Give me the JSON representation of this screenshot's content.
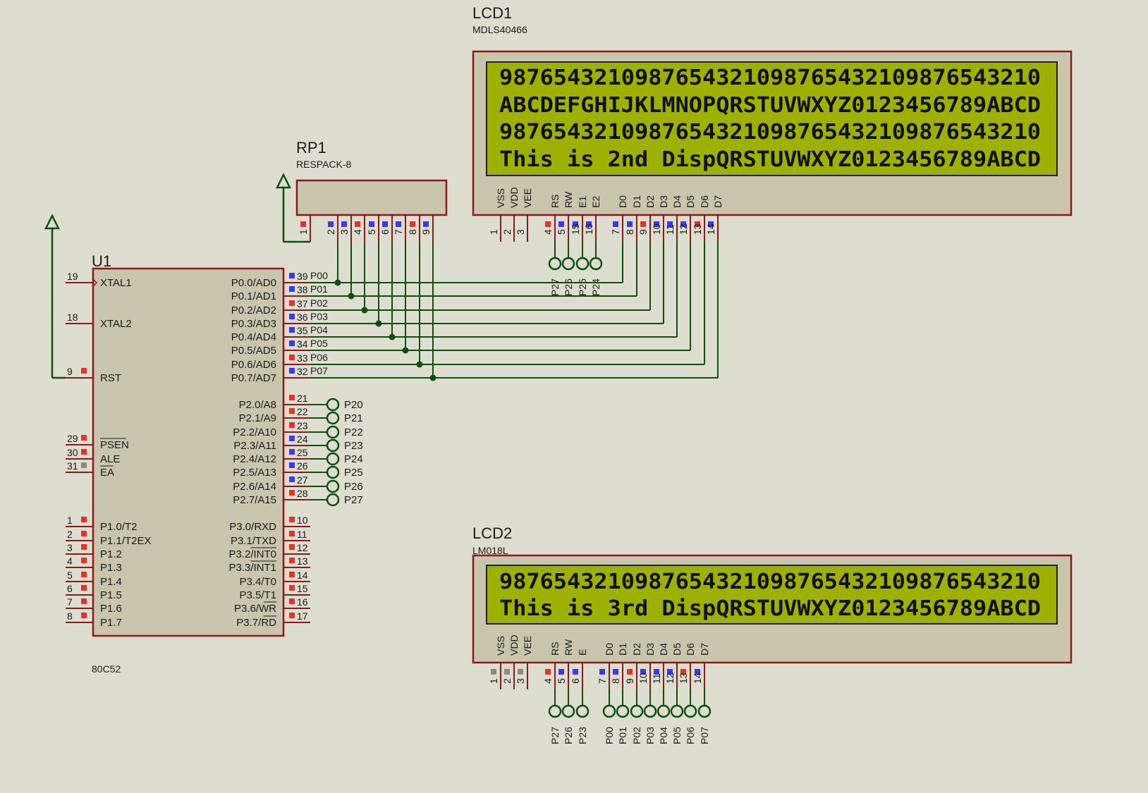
{
  "u1": {
    "ref": "U1",
    "part": "80C52",
    "left_pins": [
      {
        "num": "19",
        "name": "XTAL1",
        "dot": "none"
      },
      {
        "num": "18",
        "name": "XTAL2",
        "dot": "none"
      },
      {
        "num": "9",
        "name": "RST",
        "dot": "red"
      },
      {
        "num": "29",
        "name": "PSEN",
        "dot": "red",
        "overline": true
      },
      {
        "num": "30",
        "name": "ALE",
        "dot": "red"
      },
      {
        "num": "31",
        "name": "EA",
        "dot": "gray",
        "overline": true
      },
      {
        "num": "1",
        "name": "P1.0/T2",
        "dot": "red"
      },
      {
        "num": "2",
        "name": "P1.1/T2EX",
        "dot": "red"
      },
      {
        "num": "3",
        "name": "P1.2",
        "dot": "red"
      },
      {
        "num": "4",
        "name": "P1.3",
        "dot": "red"
      },
      {
        "num": "5",
        "name": "P1.4",
        "dot": "red"
      },
      {
        "num": "6",
        "name": "P1.5",
        "dot": "red"
      },
      {
        "num": "7",
        "name": "P1.6",
        "dot": "red"
      },
      {
        "num": "8",
        "name": "P1.7",
        "dot": "red"
      }
    ],
    "port0": [
      {
        "num": "39",
        "name": "P0.0/AD0",
        "net": "P00",
        "dot": "blue"
      },
      {
        "num": "38",
        "name": "P0.1/AD1",
        "net": "P01",
        "dot": "blue"
      },
      {
        "num": "37",
        "name": "P0.2/AD2",
        "net": "P02",
        "dot": "red"
      },
      {
        "num": "36",
        "name": "P0.3/AD3",
        "net": "P03",
        "dot": "blue"
      },
      {
        "num": "35",
        "name": "P0.4/AD4",
        "net": "P04",
        "dot": "blue"
      },
      {
        "num": "34",
        "name": "P0.5/AD5",
        "net": "P05",
        "dot": "blue"
      },
      {
        "num": "33",
        "name": "P0.6/AD6",
        "net": "P06",
        "dot": "red"
      },
      {
        "num": "32",
        "name": "P0.7/AD7",
        "net": "P07",
        "dot": "blue"
      }
    ],
    "port2": [
      {
        "num": "21",
        "name": "P2.0/A8",
        "net": "P20",
        "dot": "red"
      },
      {
        "num": "22",
        "name": "P2.1/A9",
        "net": "P21",
        "dot": "red"
      },
      {
        "num": "23",
        "name": "P2.2/A10",
        "net": "P22",
        "dot": "red"
      },
      {
        "num": "24",
        "name": "P2.3/A11",
        "net": "P23",
        "dot": "blue"
      },
      {
        "num": "25",
        "name": "P2.4/A12",
        "net": "P24",
        "dot": "blue"
      },
      {
        "num": "26",
        "name": "P2.5/A13",
        "net": "P25",
        "dot": "blue"
      },
      {
        "num": "27",
        "name": "P2.6/A14",
        "net": "P26",
        "dot": "blue"
      },
      {
        "num": "28",
        "name": "P2.7/A15",
        "net": "P27",
        "dot": "red"
      }
    ],
    "port3": [
      {
        "num": "10",
        "name": "P3.0/RXD",
        "dot": "red"
      },
      {
        "num": "11",
        "name": "P3.1/TXD",
        "dot": "red"
      },
      {
        "num": "12",
        "name": "P3.2/INT0",
        "dot": "red",
        "overline_part": "INT0"
      },
      {
        "num": "13",
        "name": "P3.3/INT1",
        "dot": "red",
        "overline_part": "INT1"
      },
      {
        "num": "14",
        "name": "P3.4/T0",
        "dot": "red"
      },
      {
        "num": "15",
        "name": "P3.5/T1",
        "dot": "red"
      },
      {
        "num": "16",
        "name": "P3.6/WR",
        "dot": "red",
        "overline_part": "WR"
      },
      {
        "num": "17",
        "name": "P3.7/RD",
        "dot": "red",
        "overline_part": "RD"
      }
    ]
  },
  "rp1": {
    "ref": "RP1",
    "part": "RESPACK-8",
    "pins": [
      {
        "num": "1",
        "dot": "red"
      },
      {
        "num": "2",
        "dot": "blue"
      },
      {
        "num": "3",
        "dot": "blue"
      },
      {
        "num": "4",
        "dot": "red"
      },
      {
        "num": "5",
        "dot": "blue"
      },
      {
        "num": "6",
        "dot": "blue"
      },
      {
        "num": "7",
        "dot": "blue"
      },
      {
        "num": "8",
        "dot": "red"
      },
      {
        "num": "9",
        "dot": "blue"
      }
    ]
  },
  "lcd1": {
    "ref": "LCD1",
    "part": "MDLS40466",
    "lines": [
      "9876543210987654321098765432109876543210",
      "ABCDEFGHIJKLMNOPQRSTUVWXYZ0123456789ABCD",
      "9876543210987654321098765432109876543210",
      "This is 2nd DispQRSTUVWXYZ0123456789ABCD"
    ],
    "pins": [
      {
        "num": "1",
        "name": "VSS",
        "dot": "none"
      },
      {
        "num": "2",
        "name": "VDD",
        "dot": "none"
      },
      {
        "num": "3",
        "name": "VEE",
        "dot": "none"
      },
      {
        "num": "4",
        "name": "RS",
        "dot": "red"
      },
      {
        "num": "5",
        "name": "RW",
        "dot": "blue"
      },
      {
        "num": "15",
        "name": "E1",
        "dot": "blue"
      },
      {
        "num": "16",
        "name": "E2",
        "dot": "blue"
      },
      {
        "num": "7",
        "name": "D0",
        "dot": "blue"
      },
      {
        "num": "8",
        "name": "D1",
        "dot": "blue"
      },
      {
        "num": "9",
        "name": "D2",
        "dot": "red"
      },
      {
        "num": "10",
        "name": "D3",
        "dot": "blue"
      },
      {
        "num": "11",
        "name": "D4",
        "dot": "blue"
      },
      {
        "num": "12",
        "name": "D5",
        "dot": "blue"
      },
      {
        "num": "13",
        "name": "D6",
        "dot": "red"
      },
      {
        "num": "14",
        "name": "D7",
        "dot": "blue"
      }
    ],
    "terminals": [
      "P27",
      "P26",
      "P25",
      "P24"
    ]
  },
  "lcd2": {
    "ref": "LCD2",
    "part": "LM018L",
    "lines": [
      "9876543210987654321098765432109876543210",
      "This is 3rd DispQRSTUVWXYZ0123456789ABCD"
    ],
    "pins": [
      {
        "num": "1",
        "name": "VSS",
        "dot": "gray"
      },
      {
        "num": "2",
        "name": "VDD",
        "dot": "gray"
      },
      {
        "num": "3",
        "name": "VEE",
        "dot": "gray"
      },
      {
        "num": "4",
        "name": "RS",
        "dot": "red"
      },
      {
        "num": "5",
        "name": "RW",
        "dot": "blue"
      },
      {
        "num": "6",
        "name": "E",
        "dot": "blue"
      },
      {
        "num": "7",
        "name": "D0",
        "dot": "blue"
      },
      {
        "num": "8",
        "name": "D1",
        "dot": "blue"
      },
      {
        "num": "9",
        "name": "D2",
        "dot": "red"
      },
      {
        "num": "10",
        "name": "D3",
        "dot": "blue"
      },
      {
        "num": "11",
        "name": "D4",
        "dot": "blue"
      },
      {
        "num": "12",
        "name": "D5",
        "dot": "blue"
      },
      {
        "num": "13",
        "name": "D6",
        "dot": "red"
      },
      {
        "num": "14",
        "name": "D7",
        "dot": "blue"
      }
    ],
    "terminals": [
      "P27",
      "P26",
      "P23",
      "P00",
      "P01",
      "P02",
      "P03",
      "P04",
      "P05",
      "P06",
      "P07"
    ]
  },
  "colors": {
    "background": "#deded0",
    "body_fill": "#c9c6ad",
    "body_stroke": "#8b1a1a",
    "wire": "#0d4f0d",
    "lcd_screen": "#9fb100",
    "lcd_text": "#111111",
    "dot_red": "#e8302a",
    "dot_blue": "#3a3ae8",
    "dot_gray": "#8a8a8a",
    "text": "#1a1a1a"
  }
}
